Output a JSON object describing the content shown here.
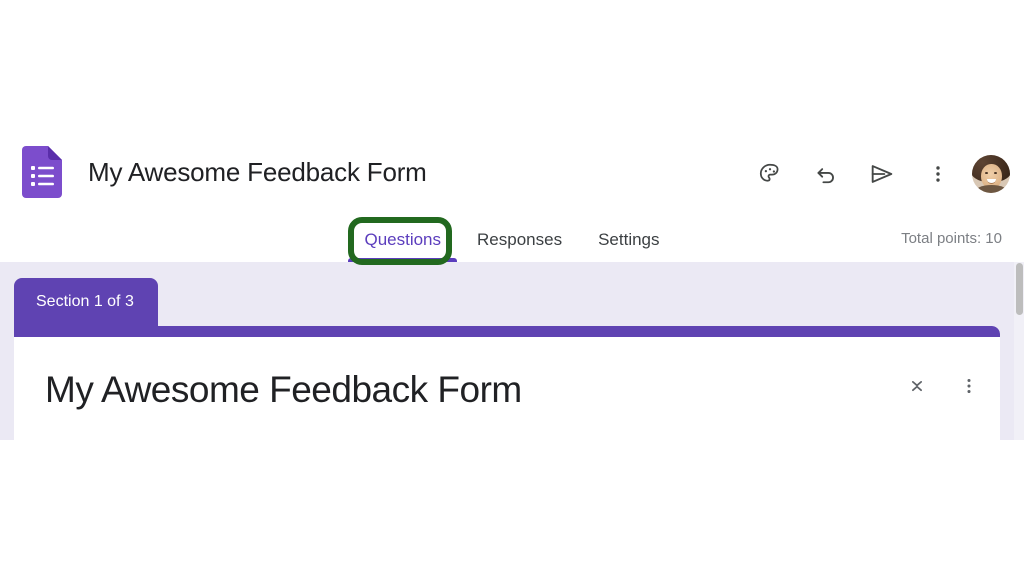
{
  "app": {
    "name": "Google Forms",
    "logo_icon": "google-forms-icon",
    "accent_purple": "#5f43b2",
    "body_background": "#ebe9f4",
    "annotation_color": "#22691f"
  },
  "header": {
    "doc_title": "My Awesome Feedback Form",
    "actions": [
      {
        "id": "theme",
        "icon": "palette-icon",
        "label": "Customize theme"
      },
      {
        "id": "undo",
        "icon": "undo-icon",
        "label": "Undo"
      },
      {
        "id": "send",
        "icon": "send-icon",
        "label": "Send"
      },
      {
        "id": "more",
        "icon": "more-vert-icon",
        "label": "More options"
      }
    ],
    "avatar": {
      "icon": "avatar",
      "label": "Google Account"
    }
  },
  "tabs": {
    "items": [
      {
        "id": "questions",
        "label": "Questions",
        "active": true,
        "highlighted": true
      },
      {
        "id": "responses",
        "label": "Responses",
        "active": false,
        "highlighted": false
      },
      {
        "id": "settings",
        "label": "Settings",
        "active": false,
        "highlighted": false
      }
    ],
    "total_points": "Total points: 10"
  },
  "form": {
    "section_tab": "Section 1 of 3",
    "card": {
      "title": "My Awesome Feedback Form",
      "actions": [
        {
          "id": "collapse",
          "icon": "collapse-icon",
          "label": "Collapse section"
        },
        {
          "id": "more",
          "icon": "more-vert-icon",
          "label": "More options"
        }
      ]
    }
  },
  "scrollbar": {
    "name": "vertical-scrollbar"
  }
}
